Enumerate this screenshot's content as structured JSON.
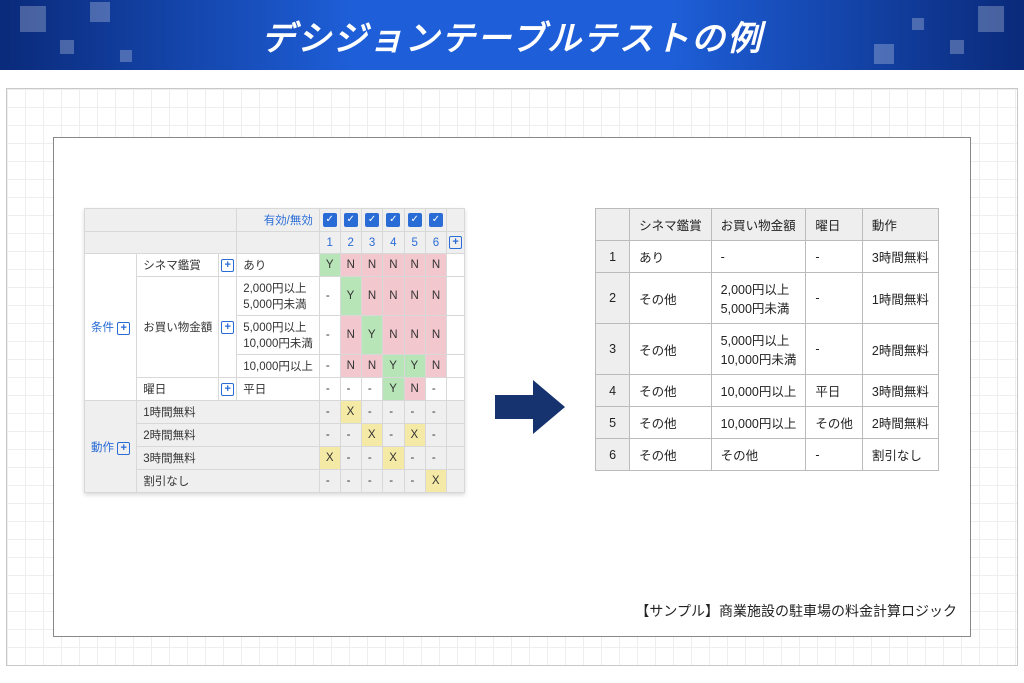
{
  "banner": {
    "title": "デシジョンテーブルテストの例"
  },
  "dt": {
    "validLabel": "有効/無効",
    "cols": [
      "1",
      "2",
      "3",
      "4",
      "5",
      "6"
    ],
    "condLabel": "条件",
    "actLabel": "動作",
    "conditions": {
      "c1label": "シネマ鑑賞",
      "c1val": "あり",
      "c2label": "お買い物金額",
      "c2val_a": "2,000円以上",
      "c2val_a2": "5,000円未満",
      "c2val_b": "5,000円以上",
      "c2val_b2": "10,000円未満",
      "c2val_c": "10,000円以上",
      "c3label": "曜日",
      "c3val": "平日"
    },
    "condCells": {
      "r1": [
        "Y",
        "N",
        "N",
        "N",
        "N",
        "N"
      ],
      "r2": [
        "-",
        "Y",
        "N",
        "N",
        "N",
        "N"
      ],
      "r3": [
        "-",
        "N",
        "Y",
        "N",
        "N",
        "N"
      ],
      "r4": [
        "-",
        "N",
        "N",
        "Y",
        "Y",
        "N"
      ],
      "r5": [
        "-",
        "-",
        "-",
        "Y",
        "N",
        "-"
      ]
    },
    "actions": {
      "a1": "1時間無料",
      "a2": "2時間無料",
      "a3": "3時間無料",
      "a4": "割引なし"
    },
    "actCells": {
      "r1": [
        "-",
        "X",
        "-",
        "-",
        "-",
        "-"
      ],
      "r2": [
        "-",
        "-",
        "X",
        "-",
        "X",
        "-"
      ],
      "r3": [
        "X",
        "-",
        "-",
        "X",
        "-",
        "-"
      ],
      "r4": [
        "-",
        "-",
        "-",
        "-",
        "-",
        "X"
      ]
    }
  },
  "ot": {
    "headers": [
      "",
      "シネマ鑑賞",
      "お買い物金額",
      "曜日",
      "動作"
    ],
    "rows": [
      {
        "n": "1",
        "c1": "あり",
        "c2": "-",
        "c3": "-",
        "a": "3時間無料"
      },
      {
        "n": "2",
        "c1": "その他",
        "c2": "2,000円以上\n5,000円未満",
        "c3": "-",
        "a": "1時間無料"
      },
      {
        "n": "3",
        "c1": "その他",
        "c2": "5,000円以上\n10,000円未満",
        "c3": "-",
        "a": "2時間無料"
      },
      {
        "n": "4",
        "c1": "その他",
        "c2": "10,000円以上",
        "c3": "平日",
        "a": "3時間無料"
      },
      {
        "n": "5",
        "c1": "その他",
        "c2": "10,000円以上",
        "c3": "その他",
        "a": "2時間無料"
      },
      {
        "n": "6",
        "c1": "その他",
        "c2": "その他",
        "c3": "-",
        "a": "割引なし"
      }
    ]
  },
  "caption": "【サンプル】商業施設の駐車場の料金計算ロジック"
}
